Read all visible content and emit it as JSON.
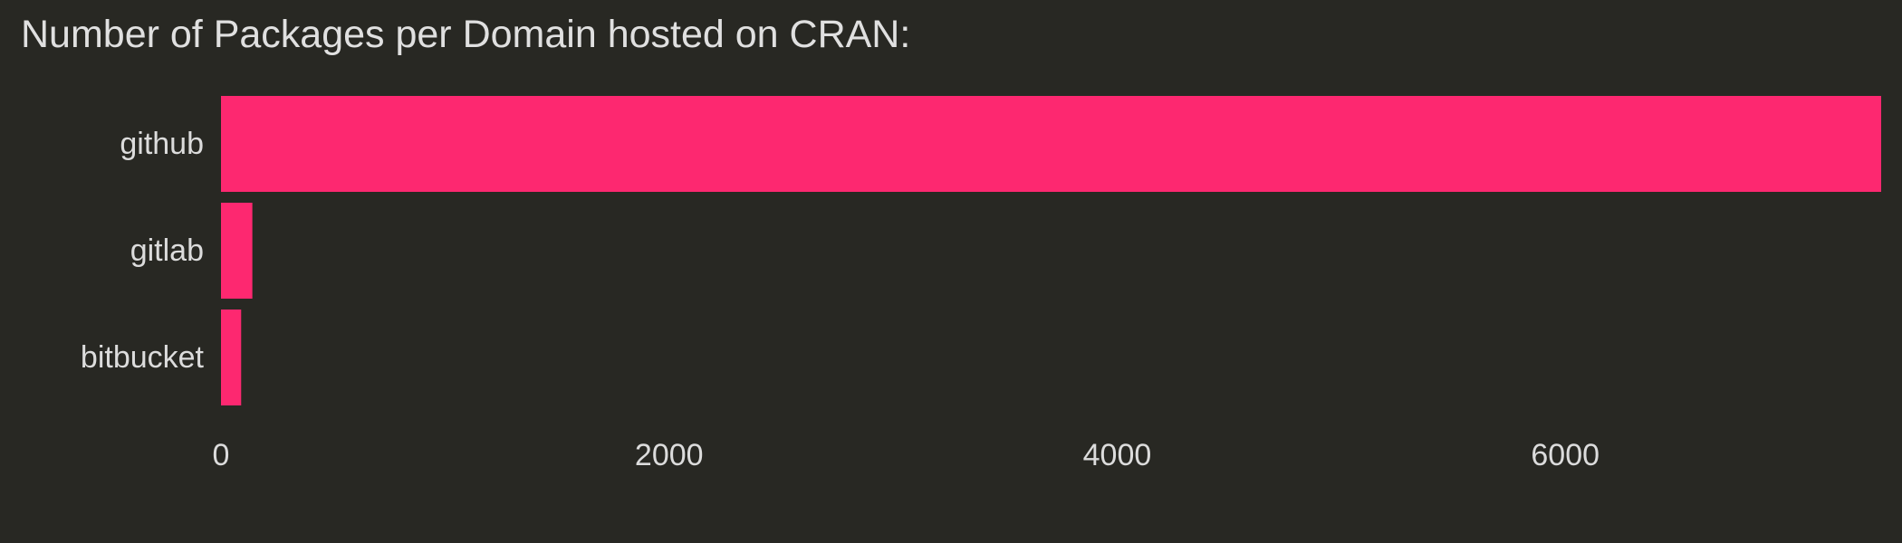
{
  "chart_data": {
    "type": "bar",
    "orientation": "horizontal",
    "title": "Number of Packages per Domain hosted on CRAN:",
    "xlabel": "",
    "ylabel": "",
    "categories": [
      "github",
      "gitlab",
      "bitbucket"
    ],
    "values": [
      7410,
      140,
      90
    ],
    "xlim": [
      0,
      7410
    ],
    "xticks": [
      0,
      2000,
      4000,
      6000
    ],
    "xtick_labels": [
      "0",
      "2000",
      "4000",
      "6000"
    ],
    "bar_color": "#fd2870",
    "background": "#282823",
    "text_color": "#dcdcdc",
    "grid": false,
    "legend": "none"
  }
}
